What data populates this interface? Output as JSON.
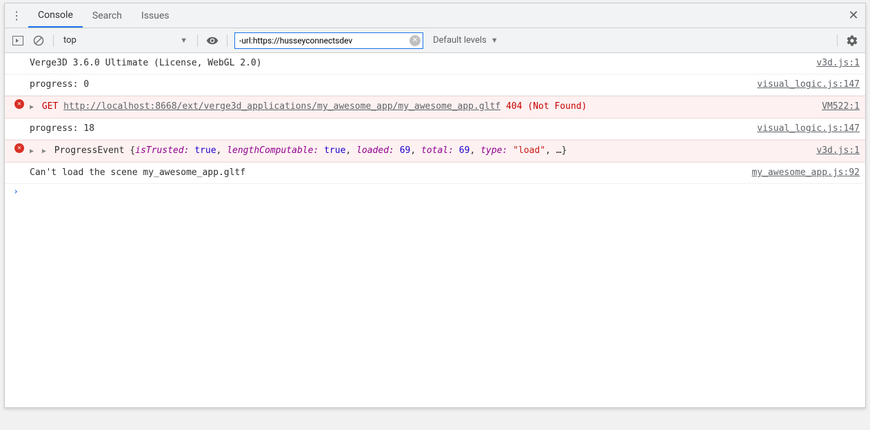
{
  "tabs": {
    "console": "Console",
    "search": "Search",
    "issues": "Issues"
  },
  "toolbar": {
    "context": "top",
    "filter_value": "-url:https://husseyconnectsdev",
    "levels_label": "Default levels"
  },
  "logs": {
    "row0": {
      "msg": "Verge3D 3.6.0 Ultimate (License, WebGL 2.0)",
      "src": "v3d.js:1"
    },
    "row1": {
      "msg": "progress: 0",
      "src": "visual_logic.js:147"
    },
    "row2": {
      "method": "GET",
      "url": "http://localhost:8668/ext/verge3d_applications/my_awesome_app/my_awesome_app.gltf",
      "status": "404 (Not Found)",
      "src": "VM522:1"
    },
    "row3": {
      "msg": "progress: 18",
      "src": "visual_logic.js:147"
    },
    "row4": {
      "cls": "ProgressEvent",
      "p1k": "isTrusted:",
      "p1v": "true",
      "p2k": "lengthComputable:",
      "p2v": "true",
      "p3k": "loaded:",
      "p3v": "69",
      "p4k": "total:",
      "p4v": "69",
      "p5k": "type:",
      "p5v": "\"load\"",
      "tail": ", …}",
      "src": "v3d.js:1"
    },
    "row5": {
      "msg": "Can't load the scene my_awesome_app.gltf",
      "src": "my_awesome_app.js:92"
    }
  }
}
